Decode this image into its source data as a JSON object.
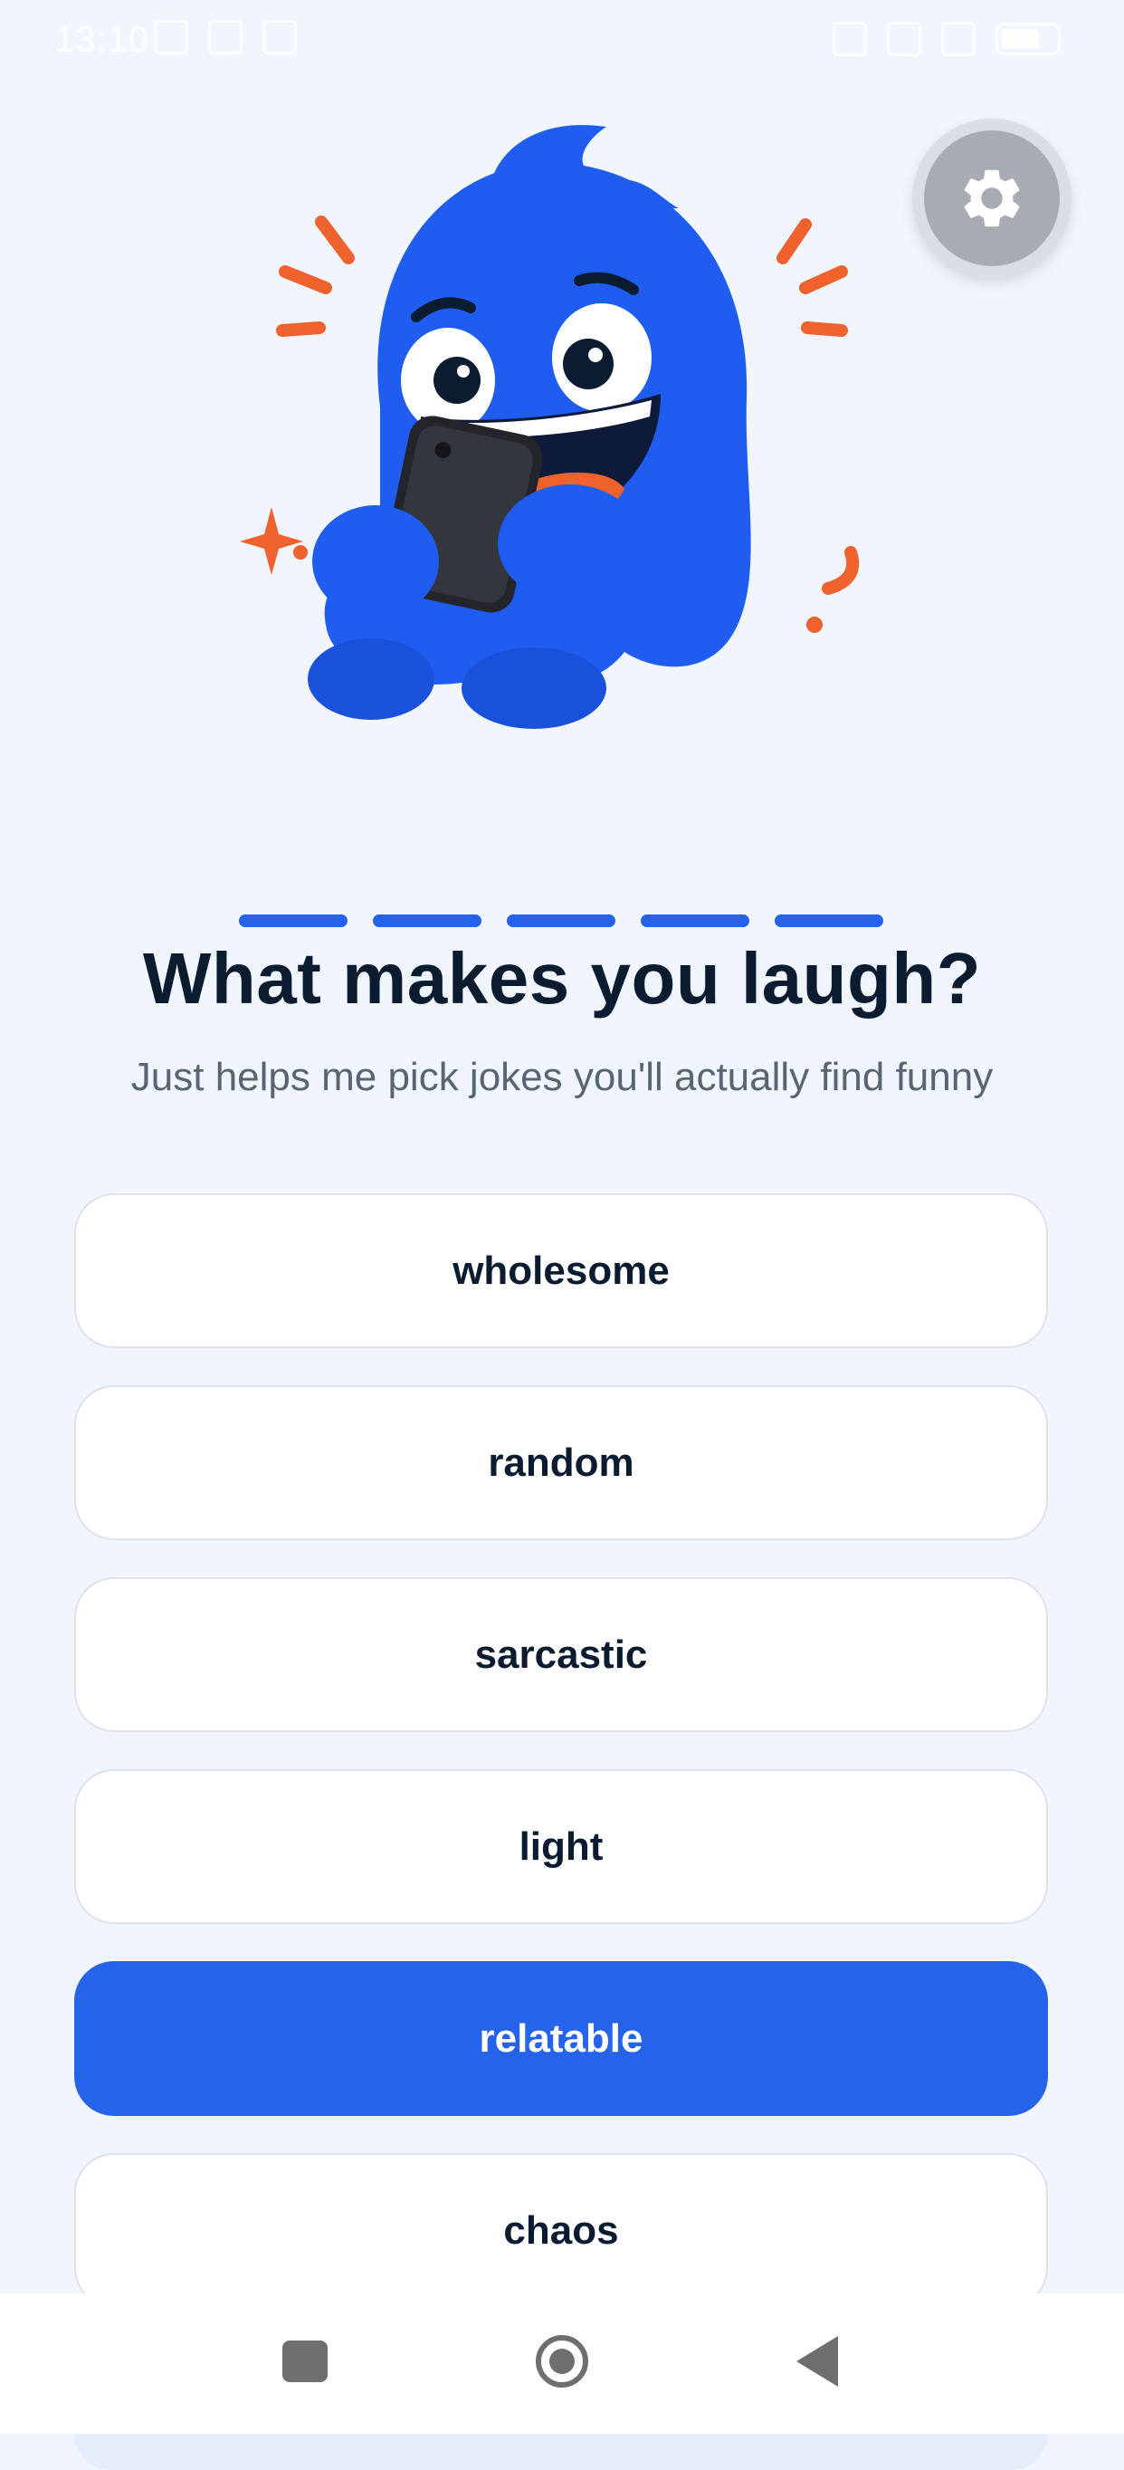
{
  "status_bar": {
    "time": "13:10"
  },
  "settings": {
    "icon": "gear-icon"
  },
  "mascot": {
    "icon": "blue-monster-laughing-at-phone"
  },
  "progress": {
    "total_steps": 5,
    "completed_steps": 5,
    "accent_color": "#2563eb"
  },
  "question": {
    "title": "What makes you laugh?",
    "subtitle": "Just helps me pick jokes you'll actually find funny"
  },
  "options": [
    {
      "label": "wholesome",
      "selected": false
    },
    {
      "label": "random",
      "selected": false
    },
    {
      "label": "sarcastic",
      "selected": false
    },
    {
      "label": "light",
      "selected": false
    },
    {
      "label": "relatable",
      "selected": true
    },
    {
      "label": "chaos",
      "selected": false
    }
  ],
  "nav": {
    "recents_icon": "square-icon",
    "home_icon": "circle-icon",
    "back_icon": "triangle-back-icon"
  },
  "colors": {
    "background": "#f1f5fd",
    "primary": "#2563eb",
    "text": "#0b1b30",
    "muted": "#5a6573",
    "mascot_blue": "#1f5cf0",
    "accent_orange": "#f0622d"
  }
}
